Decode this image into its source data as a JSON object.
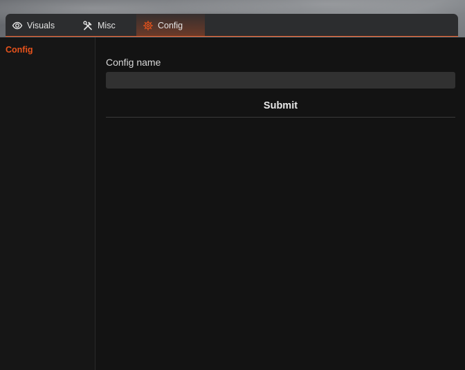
{
  "tabs": [
    {
      "label": "Visuals",
      "icon": "eye-icon"
    },
    {
      "label": "Misc",
      "icon": "tools-icon"
    },
    {
      "label": "Config",
      "icon": "gear-icon",
      "active": true
    }
  ],
  "sidebar": {
    "items": [
      {
        "label": "Config",
        "active": true
      }
    ]
  },
  "form": {
    "field_label": "Config name",
    "input_value": "",
    "input_placeholder": "",
    "submit_label": "Submit"
  },
  "colors": {
    "accent": "#e8531c",
    "panel": "#131313",
    "tabbar": "#2c2d2f",
    "input": "#313131"
  }
}
